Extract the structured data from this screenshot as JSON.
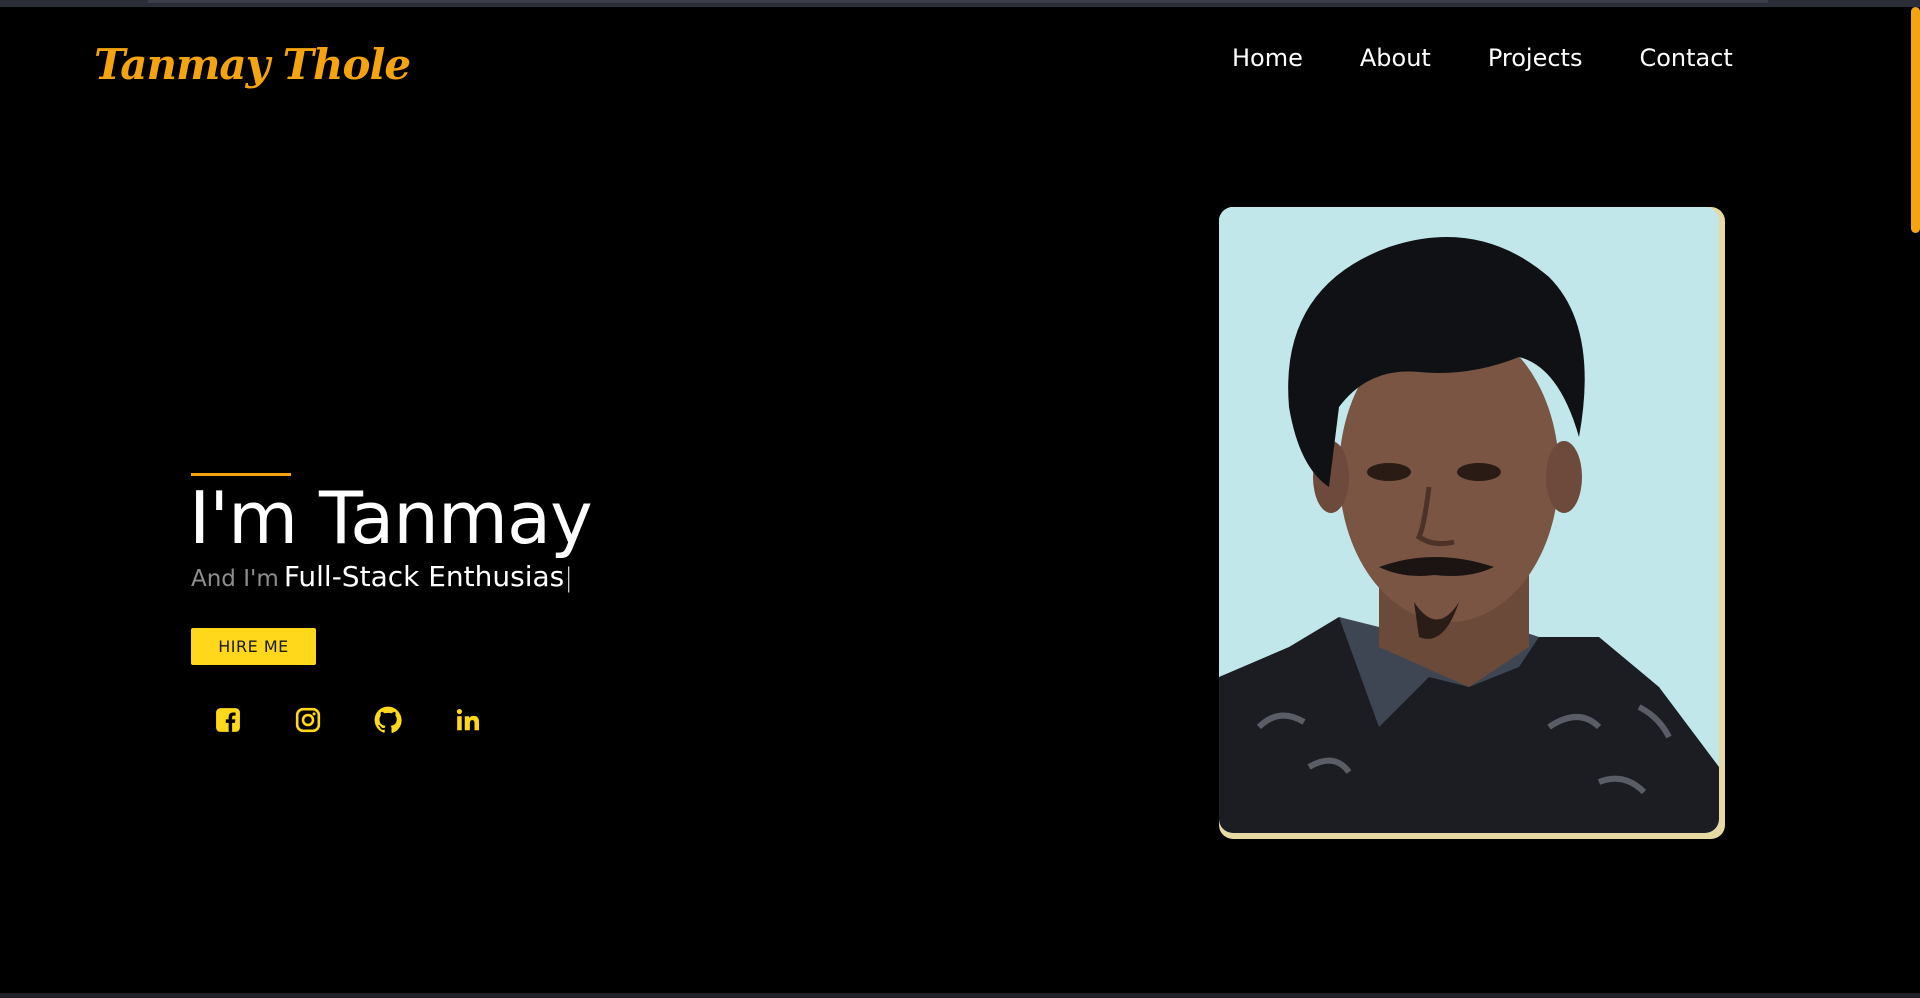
{
  "brand": {
    "logo_text": "Tanmay Thole",
    "accent_color": "#f5a40f",
    "button_color": "#ffd81c"
  },
  "nav": {
    "items": [
      "Home",
      "About",
      "Projects",
      "Contact"
    ]
  },
  "hero": {
    "title": "I'm Tanmay",
    "lead": "And I'm",
    "role_typed": "Full-Stack Enthusias",
    "cursor": "|",
    "hire_button": "HIRE ME"
  },
  "socials": [
    {
      "icon": "facebook-icon"
    },
    {
      "icon": "instagram-icon"
    },
    {
      "icon": "github-icon"
    },
    {
      "icon": "linkedin-icon"
    }
  ],
  "photo": {
    "description_icon": "profile-photo"
  }
}
